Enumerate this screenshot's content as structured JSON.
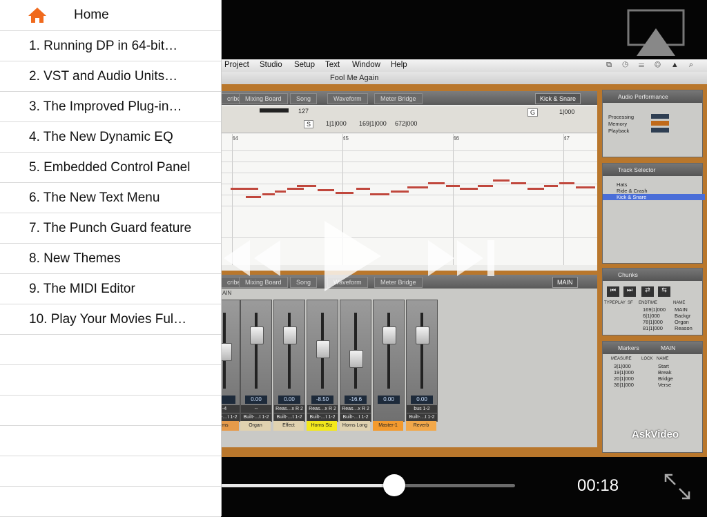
{
  "sidebar": {
    "home_label": "Home",
    "items": [
      {
        "label": "1. Running DP in 64-bit…"
      },
      {
        "label": "2. VST and Audio Units…"
      },
      {
        "label": "3. The Improved Plug-in…"
      },
      {
        "label": "4. The New Dynamic EQ"
      },
      {
        "label": "5. Embedded Control Panel"
      },
      {
        "label": "6. The New Text Menu"
      },
      {
        "label": "7. The Punch Guard feature"
      },
      {
        "label": "8. New Themes"
      },
      {
        "label": "9. The MIDI Editor"
      },
      {
        "label": "10. Play Your Movies Ful…"
      }
    ],
    "empty_rows": 6,
    "accent": "#f06a1d"
  },
  "video": {
    "menubar": [
      "Project",
      "Studio",
      "Setup",
      "Text",
      "Window",
      "Help"
    ],
    "document_title": "Fool Me Again",
    "top_tabs": [
      "cribe",
      "Mixing Board",
      "Song",
      "Waveform",
      "Meter Bridge"
    ],
    "top_tab_selected": "Kick & Snare",
    "bottom_tabs": [
      "cribe",
      "Mixing Board",
      "Song",
      "Waveform",
      "Meter Bridge"
    ],
    "bottom_tab_selected": "MAIN",
    "bottom_label": "AIN",
    "midi_toolbar": {
      "velocity": "127",
      "pos_start": "1|1|000",
      "pos_end": "169|1|000",
      "duration": "672|000",
      "quantize": "1|000",
      "s_btn": "S",
      "g_btn": "G"
    },
    "bar_numbers": [
      "44",
      "45",
      "46",
      "47"
    ],
    "mixer": {
      "values": [
        "",
        "0.00",
        "0.00",
        "-8.50",
        "-16.6",
        "0.00",
        "0.00"
      ],
      "inputs": [
        "-4",
        "--",
        "Reas…x R 2",
        "Reas…x R 2",
        "Reas…x R 2",
        "",
        "bus 1-2"
      ],
      "outputs": [
        "Built-…t 1-2",
        "Built-…t 1-2",
        "Built-…t 1-2",
        "Built-…t 1-2",
        "Built-…t 1-2",
        "",
        "Built-…t 1-2"
      ],
      "names": [
        "ums",
        "Organ",
        "Effect",
        "Horns Stz",
        "Horns Long",
        "Master-1",
        "Reverb"
      ]
    },
    "audio_performance": {
      "title": "Audio Performance",
      "rows": [
        "Processing",
        "Memory",
        "Playback"
      ]
    },
    "track_selector": {
      "title": "Track Selector",
      "tracks": [
        "Hats",
        "Ride & Crash",
        "Kick & Snare"
      ]
    },
    "chunks": {
      "title": "Chunks",
      "headers": [
        "TYPE",
        "PLAY",
        "SF",
        "ENDTIME",
        "NAME"
      ],
      "rows": [
        {
          "end": "169|1|000",
          "name": "MAIN"
        },
        {
          "end": "6|1|000",
          "name": "Backgr"
        },
        {
          "end": "78|1|000",
          "name": "Organ"
        },
        {
          "end": "81|1|000",
          "name": "Reason"
        }
      ]
    },
    "markers": {
      "title": "Markers",
      "selector": "MAIN",
      "headers": [
        "MEASURE",
        "LOCK",
        "NAME"
      ],
      "rows": [
        {
          "measure": "3|1|000",
          "name": "Start"
        },
        {
          "measure": "19|1|000",
          "name": "Break"
        },
        {
          "measure": "20|1|000",
          "name": "Bridge"
        },
        {
          "measure": "36|1|000",
          "name": "Verse"
        }
      ]
    },
    "watermark": "AskVideo",
    "playback": {
      "time": "00:18",
      "progress": 0.59
    }
  }
}
